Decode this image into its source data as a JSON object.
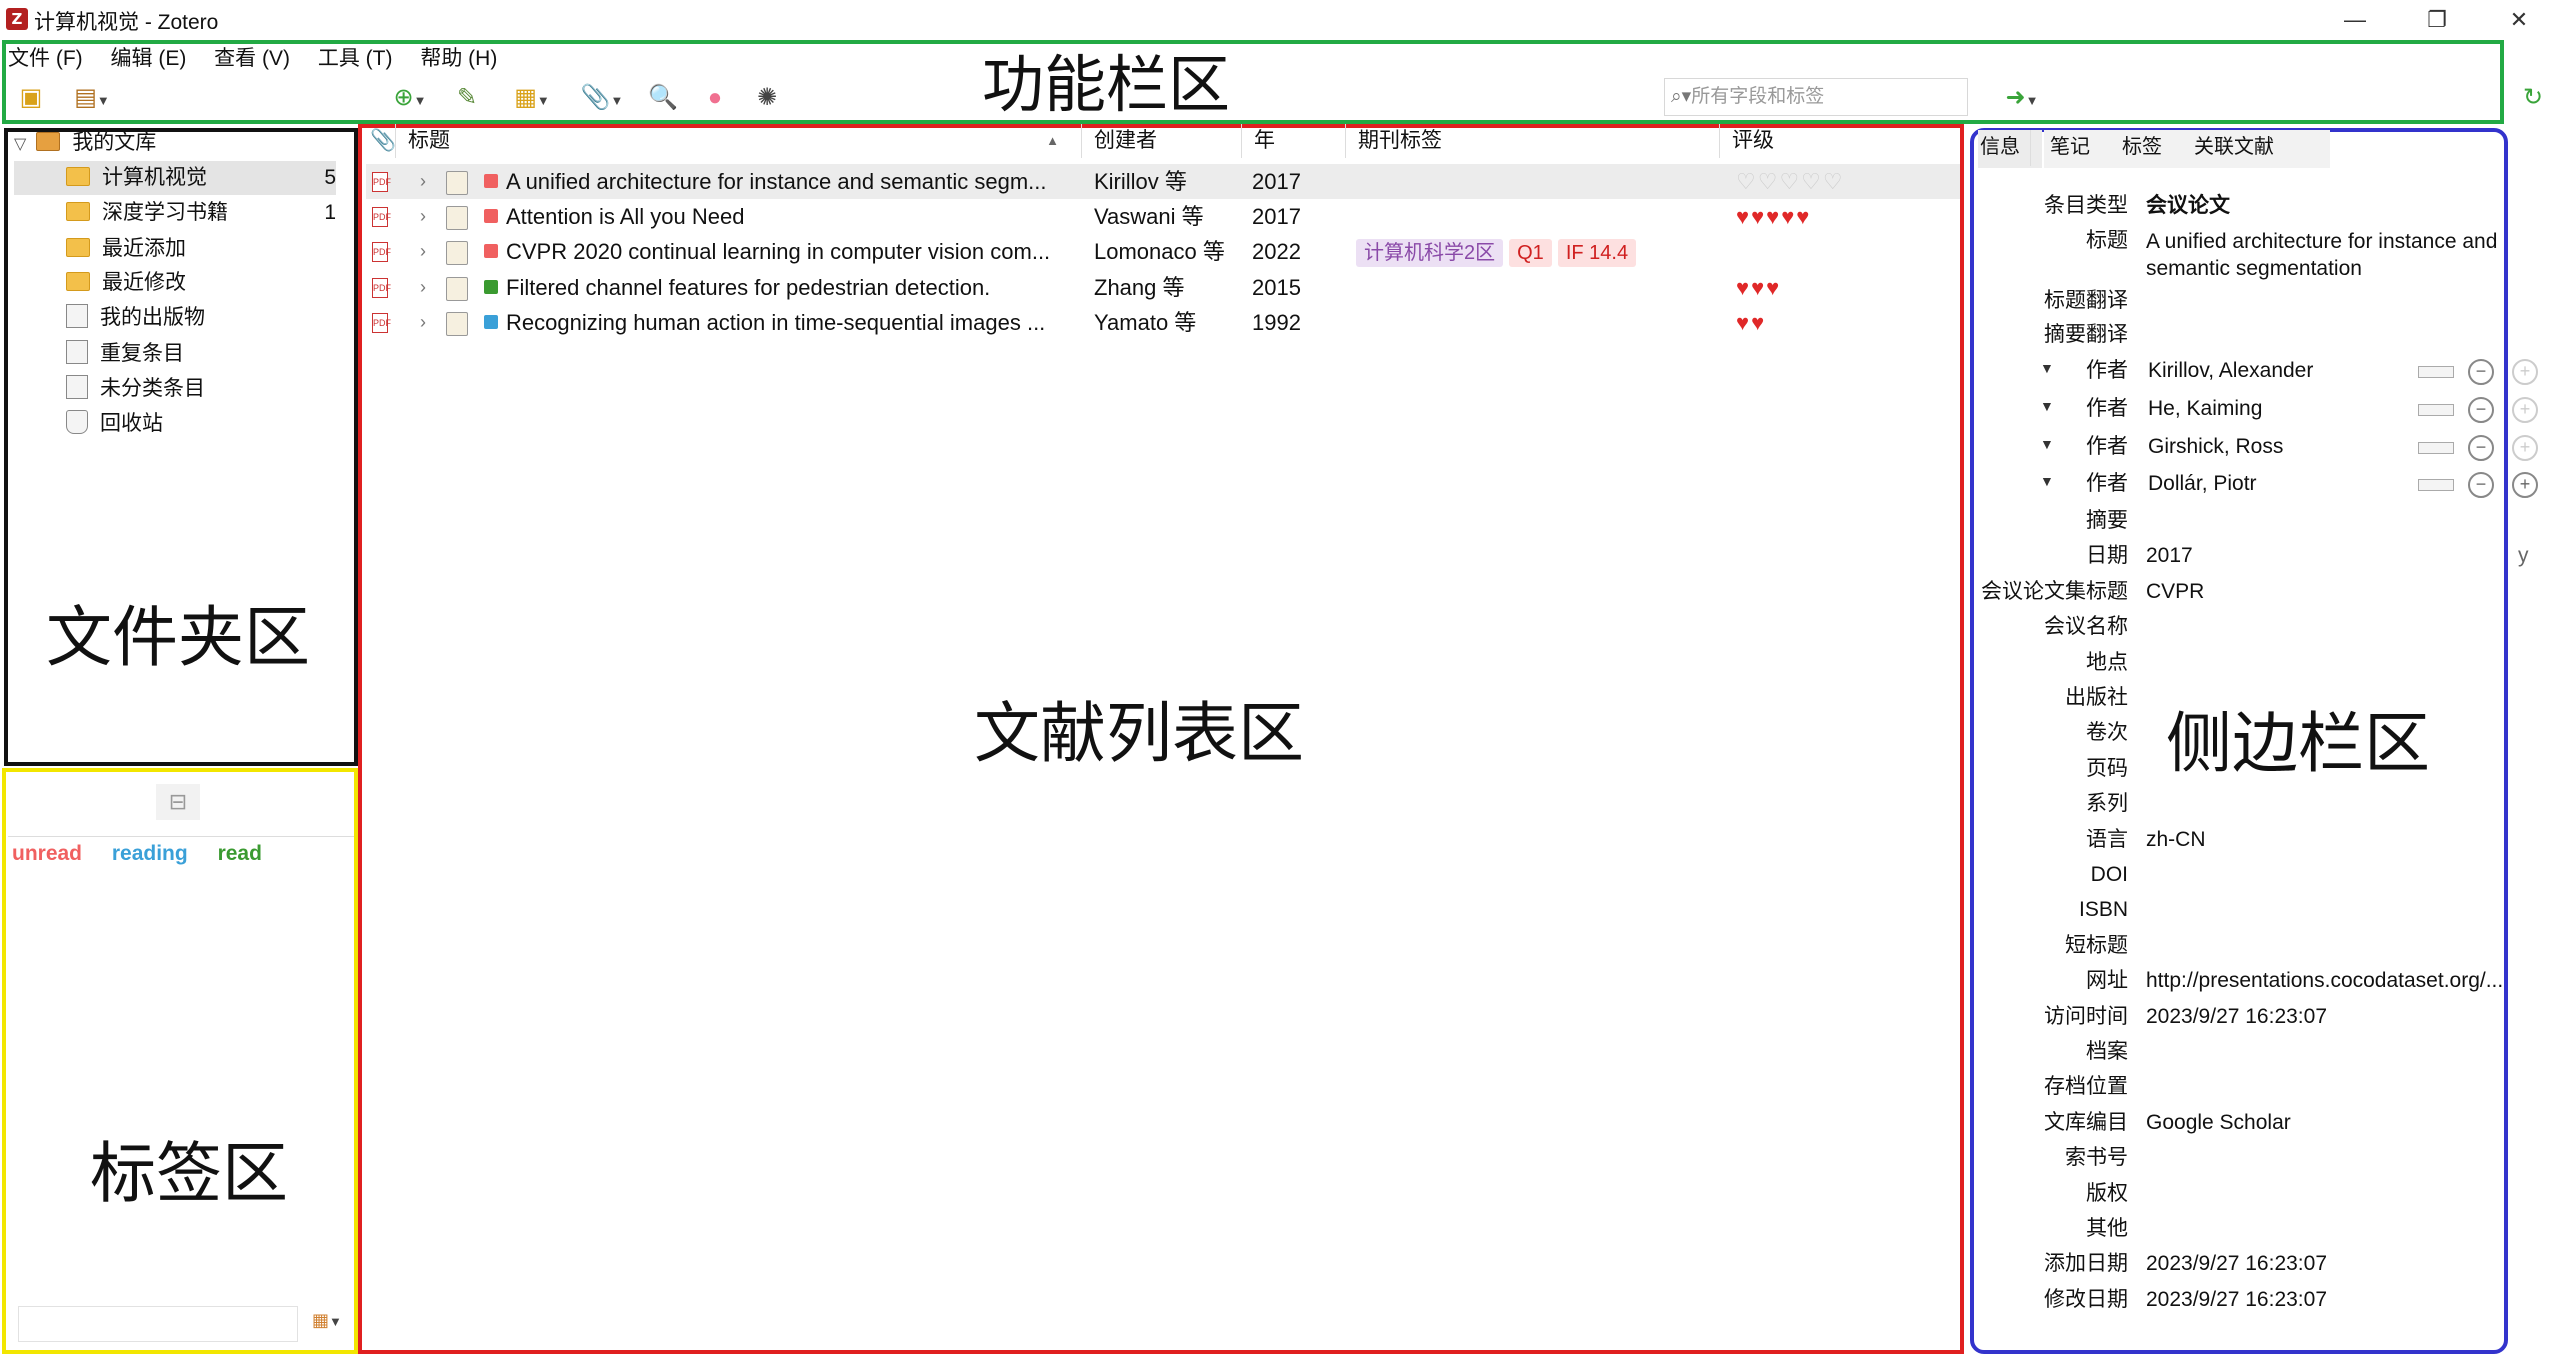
{
  "window": {
    "title": "计算机视觉 - Zotero",
    "app_icon": "zotero-icon",
    "controls": [
      "—",
      "❐",
      "✕"
    ]
  },
  "menubar": [
    "文件 (F)",
    "编辑 (E)",
    "查看 (V)",
    "工具 (T)",
    "帮助 (H)"
  ],
  "toolbar": {
    "search_placeholder": "所有字段和标签"
  },
  "region_labels": {
    "toolbar": "功能栏区",
    "folders": "文件夹区",
    "tags": "标签区",
    "items": "文献列表区",
    "sidebar": "侧边栏区"
  },
  "region_colors": {
    "toolbar": "#22aa44",
    "folders": "#111111",
    "tags": "#f2e600",
    "items": "#e02020",
    "sidebar": "#3333cc"
  },
  "collections": {
    "root": "我的文库",
    "items": [
      {
        "label": "计算机视觉",
        "count": "5",
        "icon": "folder-icon"
      },
      {
        "label": "深度学习书籍",
        "count": "1",
        "icon": "folder-icon"
      },
      {
        "label": "最近添加",
        "count": "",
        "icon": "saved-search-icon"
      },
      {
        "label": "最近修改",
        "count": "",
        "icon": "saved-search-icon"
      },
      {
        "label": "我的出版物",
        "count": "",
        "icon": "publications-icon"
      },
      {
        "label": "重复条目",
        "count": "",
        "icon": "duplicates-icon"
      },
      {
        "label": "未分类条目",
        "count": "",
        "icon": "unfiled-icon"
      },
      {
        "label": "回收站",
        "count": "",
        "icon": "trash-icon"
      }
    ]
  },
  "tags": [
    {
      "label": "unread",
      "color": "#f06060"
    },
    {
      "label": "reading",
      "color": "#3aa0d8"
    },
    {
      "label": "read",
      "color": "#3a9a30"
    }
  ],
  "columns": [
    "标题",
    "创建者",
    "年",
    "期刊标签",
    "评级"
  ],
  "items": [
    {
      "title": "A unified architecture for instance and semantic segm...",
      "creator": "Kirillov 等",
      "year": "2017",
      "color": "#f06060",
      "tags": [],
      "rating": "♡♡♡♡♡",
      "rating_level": 0
    },
    {
      "title": "Attention is All you Need",
      "creator": "Vaswani 等",
      "year": "2017",
      "color": "#f06060",
      "tags": [],
      "rating": "♥♥♥♥♥",
      "rating_level": 5
    },
    {
      "title": "CVPR 2020 continual learning in computer vision com...",
      "creator": "Lomonaco 等",
      "year": "2022",
      "color": "#f06060",
      "tags": [
        "计算机科学2区",
        "Q1",
        "IF 14.4"
      ],
      "rating": "",
      "rating_level": 0
    },
    {
      "title": "Filtered channel features for pedestrian detection.",
      "creator": "Zhang 等",
      "year": "2015",
      "color": "#3a9a30",
      "tags": [],
      "rating": "♥♥♥",
      "rating_level": 3
    },
    {
      "title": "Recognizing human action in time-sequential images ...",
      "creator": "Yamato 等",
      "year": "1992",
      "color": "#3aa0d8",
      "tags": [],
      "rating": "♥♥",
      "rating_level": 2
    }
  ],
  "sidebar": {
    "tabs": [
      "信息",
      "笔记",
      "标签",
      "关联文献"
    ],
    "item_type_label": "条目类型",
    "item_type": "会议论文",
    "title_label": "标题",
    "title_value": "A unified architecture for instance and semantic segmentation",
    "title_trans_label": "标题翻译",
    "abstract_trans_label": "摘要翻译",
    "creator_label": "作者",
    "creators": [
      "Kirillov, Alexander",
      "He, Kaiming",
      "Girshick, Ross",
      "Dollár, Piotr"
    ],
    "fields": [
      {
        "label": "摘要",
        "value": ""
      },
      {
        "label": "日期",
        "value": "2017",
        "extra": "y"
      },
      {
        "label": "会议论文集标题",
        "value": "CVPR"
      },
      {
        "label": "会议名称",
        "value": ""
      },
      {
        "label": "地点",
        "value": ""
      },
      {
        "label": "出版社",
        "value": ""
      },
      {
        "label": "卷次",
        "value": ""
      },
      {
        "label": "页码",
        "value": ""
      },
      {
        "label": "系列",
        "value": ""
      },
      {
        "label": "语言",
        "value": "zh-CN"
      },
      {
        "label": "DOI",
        "value": ""
      },
      {
        "label": "ISBN",
        "value": ""
      },
      {
        "label": "短标题",
        "value": ""
      },
      {
        "label": "网址",
        "value": "http://presentations.cocodataset.org/..."
      },
      {
        "label": "访问时间",
        "value": "2023/9/27 16:23:07"
      },
      {
        "label": "档案",
        "value": ""
      },
      {
        "label": "存档位置",
        "value": ""
      },
      {
        "label": "文库编目",
        "value": "Google Scholar"
      },
      {
        "label": "索书号",
        "value": ""
      },
      {
        "label": "版权",
        "value": ""
      },
      {
        "label": "其他",
        "value": ""
      },
      {
        "label": "添加日期",
        "value": "2023/9/27 16:23:07"
      },
      {
        "label": "修改日期",
        "value": "2023/9/27 16:23:07"
      }
    ]
  }
}
